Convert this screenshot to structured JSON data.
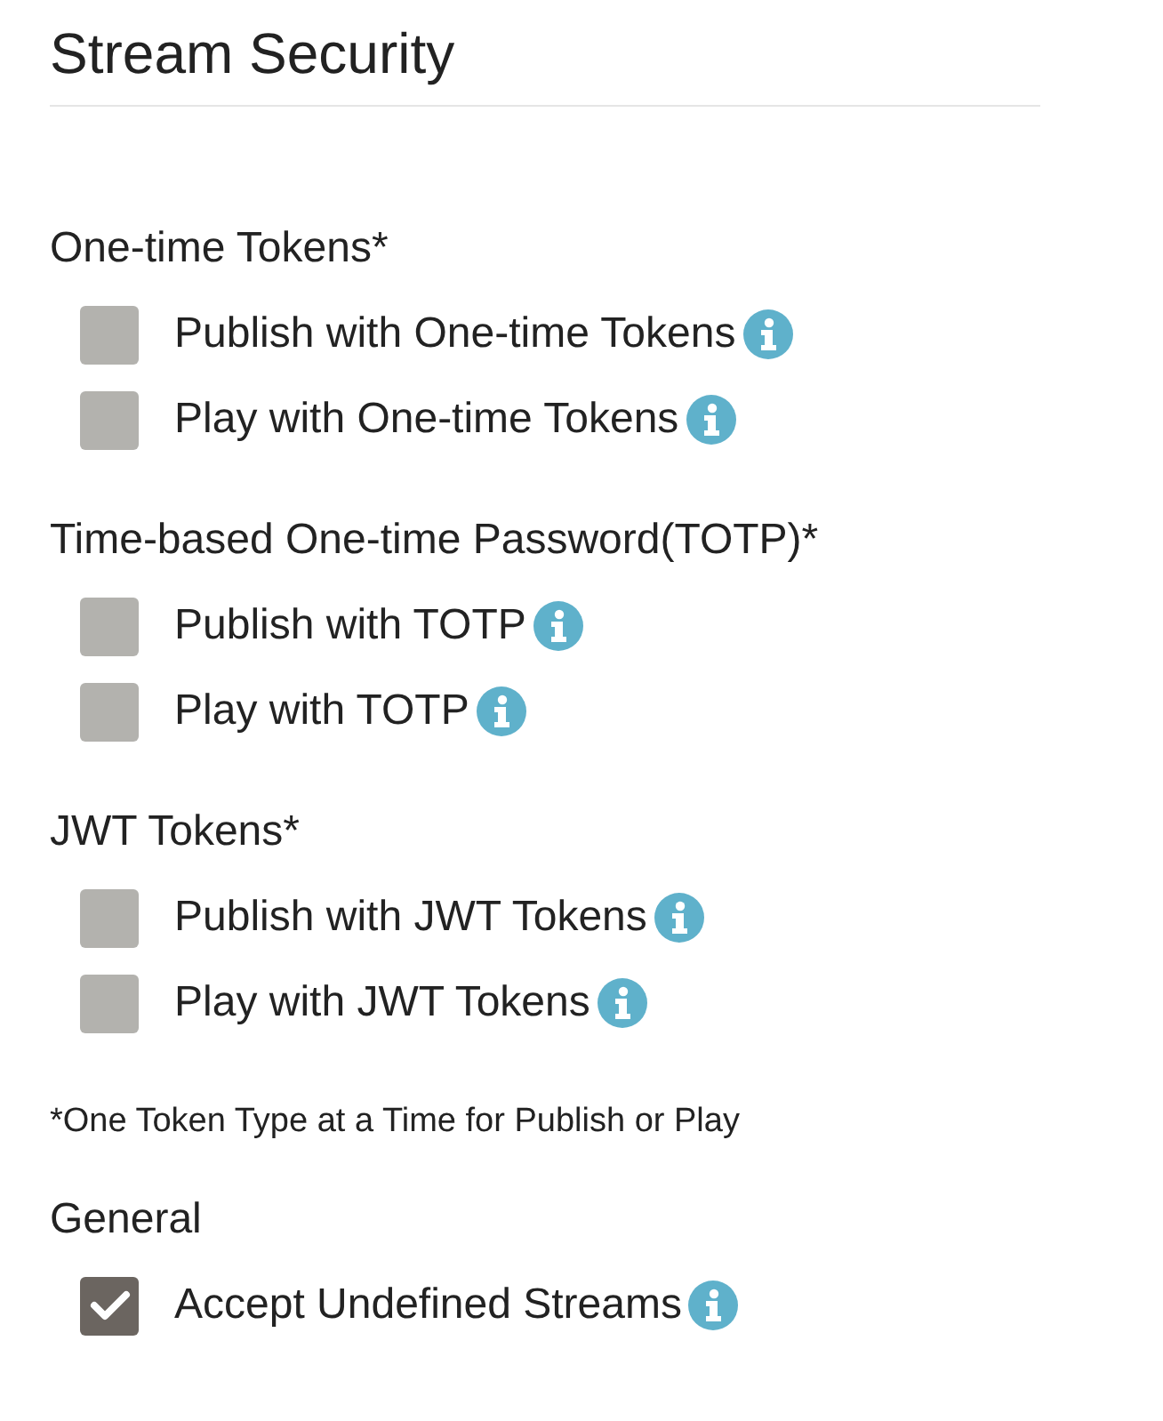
{
  "title": "Stream Security",
  "sections": [
    {
      "heading": "One-time Tokens*",
      "options": [
        {
          "label": "Publish with One-time Tokens",
          "checked": false
        },
        {
          "label": "Play with One-time Tokens",
          "checked": false
        }
      ]
    },
    {
      "heading": "Time-based One-time Password(TOTP)*",
      "options": [
        {
          "label": "Publish with TOTP",
          "checked": false
        },
        {
          "label": "Play with TOTP",
          "checked": false
        }
      ]
    },
    {
      "heading": "JWT Tokens*",
      "options": [
        {
          "label": "Publish with JWT Tokens",
          "checked": false
        },
        {
          "label": "Play with JWT Tokens",
          "checked": false
        }
      ]
    }
  ],
  "footnote": "*One Token Type at a Time for Publish or Play",
  "general": {
    "heading": "General",
    "options": [
      {
        "label": "Accept Undefined Streams",
        "checked": true
      }
    ]
  }
}
